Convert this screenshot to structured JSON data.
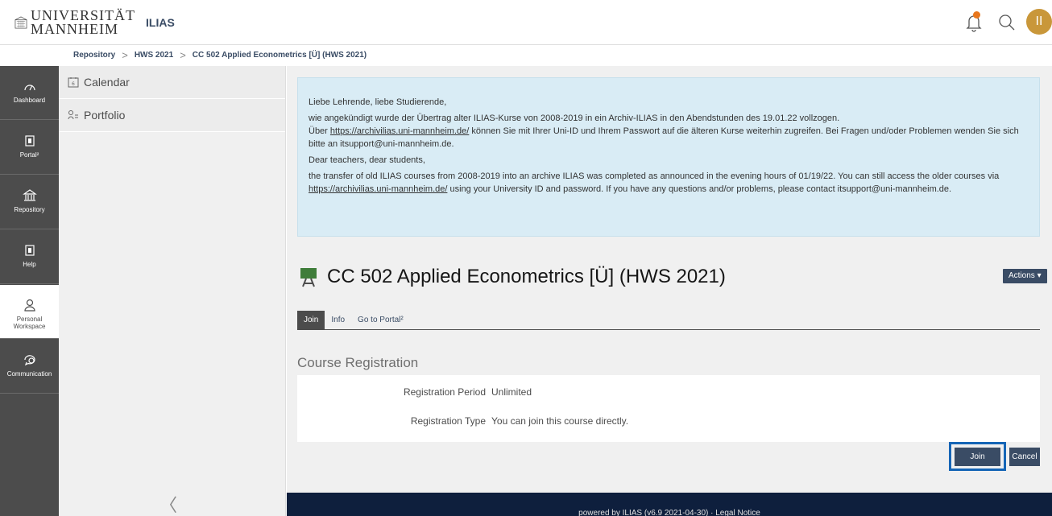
{
  "header": {
    "logo_text_line1": "UNIVERSITÄT",
    "logo_text_line2": "MANNHEIM",
    "app_name": "ILIAS",
    "avatar_initial": "II",
    "notification_icon": "bell-icon",
    "search_icon": "search-icon",
    "notification_badge_color": "#e8761c",
    "avatar_color": "#c9973a"
  },
  "breadcrumb": [
    "Repository",
    "HWS 2021",
    "CC 502 Applied Econometrics [Ü] (HWS 2021)"
  ],
  "mainbar": {
    "items": [
      {
        "label": "Dashboard",
        "icon": "dashboard-icon"
      },
      {
        "label": "Portal²",
        "icon": "portal-icon"
      },
      {
        "label": "Repository",
        "icon": "repository-icon"
      },
      {
        "label": "Help",
        "icon": "help-icon"
      },
      {
        "label": "Personal Workspace",
        "icon": "person-icon"
      },
      {
        "label": "Communication",
        "icon": "communication-icon"
      }
    ]
  },
  "slate": {
    "items": [
      {
        "label": "Calendar",
        "icon": "calendar-icon"
      },
      {
        "label": "Portfolio",
        "icon": "portfolio-icon"
      }
    ],
    "collapse_icon": "chevron-left-icon"
  },
  "notice": {
    "greeting_de": "Liebe Lehrende, liebe Studierende,",
    "body_de_1": "wie angekündigt wurde der Übertrag alter ILIAS-Kurse von 2008-2019 in ein Archiv-ILIAS in den Abendstunden des 19.01.22 vollzogen.",
    "body_de_2_pre": "Über ",
    "link": "https://archivilias.uni-mannheim.de/",
    "body_de_2_post": " können Sie mit Ihrer Uni-ID und Ihrem Passwort auf die älteren Kurse weiterhin zugreifen. Bei Fragen und/oder Problemen wenden Sie sich bitte an itsupport@uni-mannheim.de.",
    "greeting_en": "Dear teachers, dear students,",
    "body_en_pre": "the transfer of old ILIAS courses from 2008-2019 into an archive ILIAS was completed as announced in the evening hours of 01/19/22. You can still access the older courses via ",
    "body_en_post": " using your University ID and password. If you have any questions and/or problems, please contact itsupport@uni-mannheim.de."
  },
  "course": {
    "title": "CC 502 Applied Econometrics [Ü] (HWS 2021)",
    "icon": "course-icon",
    "actions_label": "Actions ▾"
  },
  "tabs": [
    {
      "label": "Join",
      "active": true
    },
    {
      "label": "Info",
      "active": false
    },
    {
      "label": "Go to Portal²",
      "active": false
    }
  ],
  "registration": {
    "section_title": "Course Registration",
    "period_label": "Registration Period",
    "period_value": "Unlimited",
    "type_label": "Registration Type",
    "type_value": "You can join this course directly."
  },
  "buttons": {
    "join": "Join",
    "cancel": "Cancel"
  },
  "footer": {
    "text": "powered by ILIAS (v6.9 2021-04-30)  ·  Legal Notice"
  }
}
